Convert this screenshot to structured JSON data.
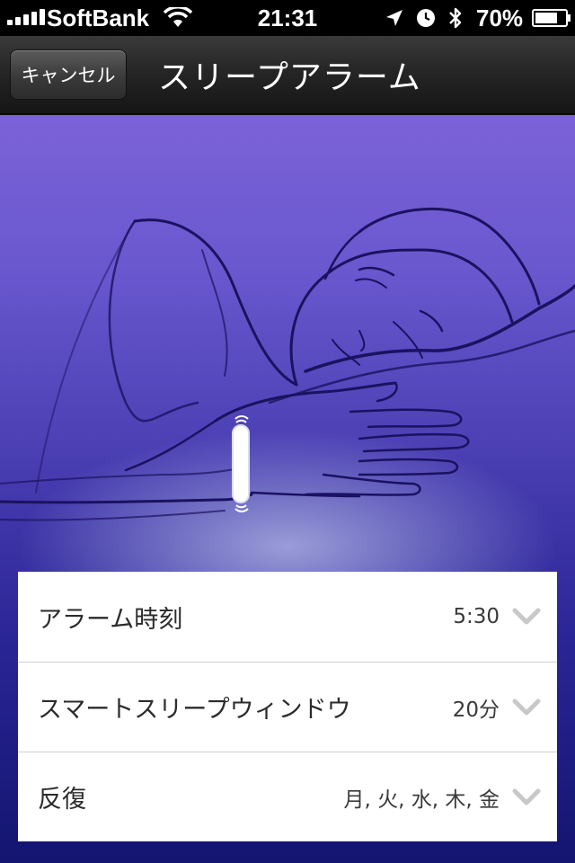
{
  "status_bar": {
    "carrier": "SoftBank",
    "time": "21:31",
    "battery": "70%"
  },
  "nav": {
    "cancel_label": "キャンセル",
    "title": "スリープアラーム"
  },
  "settings": {
    "rows": [
      {
        "label": "アラーム時刻",
        "value": "5:30"
      },
      {
        "label": "スマートスリープウィンドウ",
        "value": "20分"
      },
      {
        "label": "反復",
        "value": "月, 火, 水, 木, 金"
      }
    ]
  },
  "colors": {
    "background_top": "#7c62d8",
    "background_bottom": "#131570",
    "line_art": "#1b1260"
  },
  "icons": [
    "signal-icon",
    "wifi-icon",
    "location-icon",
    "alarm-clock-icon",
    "bluetooth-icon",
    "battery-icon",
    "chevron-down-icon",
    "wristband-icon"
  ]
}
